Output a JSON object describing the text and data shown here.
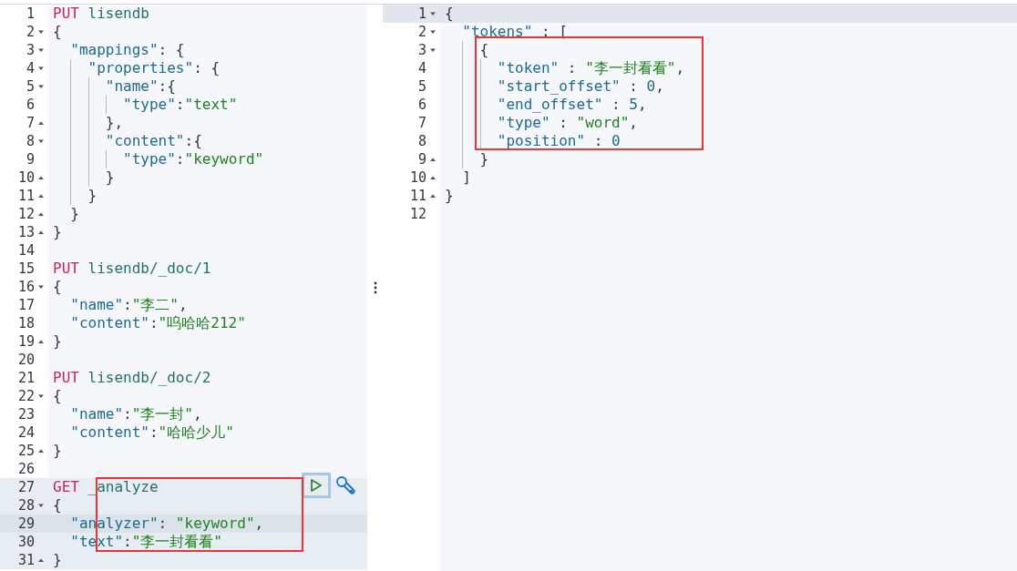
{
  "request_editor": {
    "lines": [
      {
        "number": "1",
        "fold_start": false,
        "fold_end": false,
        "in_request": false,
        "current": false,
        "tokens": [
          {
            "kind": "method",
            "text": "PUT"
          },
          {
            "kind": "path",
            "text": " lisendb"
          }
        ]
      },
      {
        "number": "2",
        "fold_start": true,
        "fold_end": false,
        "in_request": false,
        "current": false,
        "tokens": [
          {
            "kind": "punct",
            "text": "{"
          }
        ],
        "children": [
          {
            "number": "3",
            "fold_start": true,
            "fold_end": false,
            "in_request": false,
            "current": false,
            "tokens": [
              {
                "kind": "key",
                "text": "\"mappings\""
              },
              {
                "kind": "punct",
                "text": ": {"
              }
            ],
            "children": [
              {
                "number": "4",
                "fold_start": true,
                "fold_end": false,
                "in_request": false,
                "current": false,
                "tokens": [
                  {
                    "kind": "key",
                    "text": "\"properties\""
                  },
                  {
                    "kind": "punct",
                    "text": ": {"
                  }
                ],
                "children": [
                  {
                    "number": "5",
                    "fold_start": true,
                    "fold_end": false,
                    "in_request": false,
                    "current": false,
                    "tokens": [
                      {
                        "kind": "key",
                        "text": "\"name\""
                      },
                      {
                        "kind": "punct",
                        "text": ":{"
                      }
                    ],
                    "children": [
                      {
                        "number": "6",
                        "fold_start": false,
                        "fold_end": false,
                        "in_request": false,
                        "current": false,
                        "tokens": [
                          {
                            "kind": "key",
                            "text": "\"type\""
                          },
                          {
                            "kind": "punct",
                            "text": ":"
                          },
                          {
                            "kind": "string",
                            "text": "\"text\""
                          }
                        ]
                      }
                    ]
                  },
                  {
                    "number": "7",
                    "fold_start": false,
                    "fold_end": true,
                    "in_request": false,
                    "current": false,
                    "tokens": [
                      {
                        "kind": "punct",
                        "text": "},"
                      }
                    ]
                  },
                  {
                    "number": "8",
                    "fold_start": true,
                    "fold_end": false,
                    "in_request": false,
                    "current": false,
                    "tokens": [
                      {
                        "kind": "key",
                        "text": "\"content\""
                      },
                      {
                        "kind": "punct",
                        "text": ":{"
                      }
                    ],
                    "children": [
                      {
                        "number": "9",
                        "fold_start": false,
                        "fold_end": false,
                        "in_request": false,
                        "current": false,
                        "tokens": [
                          {
                            "kind": "key",
                            "text": "\"type\""
                          },
                          {
                            "kind": "punct",
                            "text": ":"
                          },
                          {
                            "kind": "string",
                            "text": "\"keyword\""
                          }
                        ]
                      }
                    ]
                  },
                  {
                    "number": "10",
                    "fold_start": false,
                    "fold_end": true,
                    "in_request": false,
                    "current": false,
                    "tokens": [
                      {
                        "kind": "punct",
                        "text": "}"
                      }
                    ]
                  }
                ]
              },
              {
                "number": "11",
                "fold_start": false,
                "fold_end": true,
                "in_request": false,
                "current": false,
                "tokens": [
                  {
                    "kind": "punct",
                    "text": "}"
                  }
                ]
              }
            ]
          },
          {
            "number": "12",
            "fold_start": false,
            "fold_end": true,
            "in_request": false,
            "current": false,
            "tokens": [
              {
                "kind": "punct",
                "text": "}"
              }
            ]
          }
        ]
      },
      {
        "number": "13",
        "fold_start": false,
        "fold_end": true,
        "in_request": false,
        "current": false,
        "tokens": [
          {
            "kind": "punct",
            "text": "}"
          }
        ]
      },
      {
        "number": "14",
        "fold_start": false,
        "fold_end": false,
        "in_request": false,
        "current": false
      },
      {
        "number": "15",
        "fold_start": false,
        "fold_end": false,
        "in_request": false,
        "current": false,
        "tokens": [
          {
            "kind": "method",
            "text": "PUT"
          },
          {
            "kind": "path",
            "text": " lisendb/_doc/1"
          }
        ]
      },
      {
        "number": "16",
        "fold_start": true,
        "fold_end": false,
        "in_request": false,
        "current": false,
        "tokens": [
          {
            "kind": "punct",
            "text": "{"
          }
        ],
        "children": [
          {
            "number": "17",
            "fold_start": false,
            "fold_end": false,
            "in_request": false,
            "current": false,
            "tokens": [
              {
                "kind": "key",
                "text": "\"name\""
              },
              {
                "kind": "punct",
                "text": ":"
              },
              {
                "kind": "string",
                "text": "\"李二\""
              },
              {
                "kind": "punct",
                "text": ","
              }
            ]
          },
          {
            "number": "18",
            "fold_start": false,
            "fold_end": false,
            "in_request": false,
            "current": false,
            "tokens": [
              {
                "kind": "key",
                "text": "\"content\""
              },
              {
                "kind": "punct",
                "text": ":"
              },
              {
                "kind": "string",
                "text": "\"呜哈哈212\""
              }
            ]
          }
        ]
      },
      {
        "number": "19",
        "fold_start": false,
        "fold_end": true,
        "in_request": false,
        "current": false,
        "tokens": [
          {
            "kind": "punct",
            "text": "}"
          }
        ]
      },
      {
        "number": "20",
        "fold_start": false,
        "fold_end": false,
        "in_request": false,
        "current": false
      },
      {
        "number": "21",
        "fold_start": false,
        "fold_end": false,
        "in_request": false,
        "current": false,
        "tokens": [
          {
            "kind": "method",
            "text": "PUT"
          },
          {
            "kind": "path",
            "text": " lisendb/_doc/2"
          }
        ]
      },
      {
        "number": "22",
        "fold_start": true,
        "fold_end": false,
        "in_request": false,
        "current": false,
        "tokens": [
          {
            "kind": "punct",
            "text": "{"
          }
        ],
        "children": [
          {
            "number": "23",
            "fold_start": false,
            "fold_end": false,
            "in_request": false,
            "current": false,
            "tokens": [
              {
                "kind": "key",
                "text": "\"name\""
              },
              {
                "kind": "punct",
                "text": ":"
              },
              {
                "kind": "string",
                "text": "\"李一封\""
              },
              {
                "kind": "punct",
                "text": ","
              }
            ]
          },
          {
            "number": "24",
            "fold_start": false,
            "fold_end": false,
            "in_request": false,
            "current": false,
            "tokens": [
              {
                "kind": "key",
                "text": "\"content\""
              },
              {
                "kind": "punct",
                "text": ":"
              },
              {
                "kind": "string",
                "text": "\"哈哈少儿\""
              }
            ]
          }
        ]
      },
      {
        "number": "25",
        "fold_start": false,
        "fold_end": true,
        "in_request": false,
        "current": false,
        "tokens": [
          {
            "kind": "punct",
            "text": "}"
          }
        ]
      },
      {
        "number": "26",
        "fold_start": false,
        "fold_end": false,
        "in_request": false,
        "current": false
      },
      {
        "number": "27",
        "fold_start": false,
        "fold_end": false,
        "in_request": true,
        "current": false,
        "tokens": [
          {
            "kind": "method",
            "text": "GET"
          },
          {
            "kind": "path",
            "text": " _analyze"
          }
        ]
      },
      {
        "number": "28",
        "fold_start": true,
        "fold_end": false,
        "in_request": true,
        "current": false,
        "tokens": [
          {
            "kind": "punct",
            "text": "{"
          }
        ],
        "children": [
          {
            "number": "29",
            "fold_start": false,
            "fold_end": false,
            "in_request": true,
            "current": true,
            "tokens": [
              {
                "kind": "key",
                "text": "\"analyzer\""
              },
              {
                "kind": "punct",
                "text": ": "
              },
              {
                "kind": "string",
                "text": "\"keyword\""
              },
              {
                "kind": "punct",
                "text": ","
              }
            ]
          },
          {
            "number": "30",
            "fold_start": false,
            "fold_end": false,
            "in_request": true,
            "current": false,
            "tokens": [
              {
                "kind": "key",
                "text": "\"text\""
              },
              {
                "kind": "punct",
                "text": ":"
              },
              {
                "kind": "string",
                "text": "\"李一封看看\""
              }
            ]
          }
        ]
      },
      {
        "number": "31",
        "fold_start": false,
        "fold_end": true,
        "in_request": true,
        "current": false,
        "tokens": [
          {
            "kind": "punct",
            "text": "}"
          }
        ]
      }
    ]
  },
  "response_editor": {
    "lines": [
      {
        "number": "1",
        "fold_start": true,
        "fold_end": false,
        "in_request": false,
        "current": true,
        "tokens": [
          {
            "kind": "punct",
            "text": "{"
          }
        ],
        "children": [
          {
            "number": "2",
            "fold_start": true,
            "fold_end": false,
            "in_request": false,
            "current": false,
            "tokens": [
              {
                "kind": "key",
                "text": "\"tokens\""
              },
              {
                "kind": "punct",
                "text": " : ["
              }
            ],
            "children": [
              {
                "number": "3",
                "fold_start": true,
                "fold_end": false,
                "in_request": false,
                "current": false,
                "tokens": [
                  {
                    "kind": "punct",
                    "text": "{"
                  }
                ],
                "children": [
                  {
                    "number": "4",
                    "fold_start": false,
                    "fold_end": false,
                    "in_request": false,
                    "current": false,
                    "tokens": [
                      {
                        "kind": "key",
                        "text": "\"token\""
                      },
                      {
                        "kind": "punct",
                        "text": " : "
                      },
                      {
                        "kind": "string",
                        "text": "\"李一封看看\""
                      },
                      {
                        "kind": "punct",
                        "text": ","
                      }
                    ]
                  },
                  {
                    "number": "5",
                    "fold_start": false,
                    "fold_end": false,
                    "in_request": false,
                    "current": false,
                    "tokens": [
                      {
                        "kind": "key",
                        "text": "\"start_offset\""
                      },
                      {
                        "kind": "punct",
                        "text": " : "
                      },
                      {
                        "kind": "number",
                        "text": "0"
                      },
                      {
                        "kind": "punct",
                        "text": ","
                      }
                    ]
                  },
                  {
                    "number": "6",
                    "fold_start": false,
                    "fold_end": false,
                    "in_request": false,
                    "current": false,
                    "tokens": [
                      {
                        "kind": "key",
                        "text": "\"end_offset\""
                      },
                      {
                        "kind": "punct",
                        "text": " : "
                      },
                      {
                        "kind": "number",
                        "text": "5"
                      },
                      {
                        "kind": "punct",
                        "text": ","
                      }
                    ]
                  },
                  {
                    "number": "7",
                    "fold_start": false,
                    "fold_end": false,
                    "in_request": false,
                    "current": false,
                    "tokens": [
                      {
                        "kind": "key",
                        "text": "\"type\""
                      },
                      {
                        "kind": "punct",
                        "text": " : "
                      },
                      {
                        "kind": "string",
                        "text": "\"word\""
                      },
                      {
                        "kind": "punct",
                        "text": ","
                      }
                    ]
                  },
                  {
                    "number": "8",
                    "fold_start": false,
                    "fold_end": false,
                    "in_request": false,
                    "current": false,
                    "tokens": [
                      {
                        "kind": "key",
                        "text": "\"position\""
                      },
                      {
                        "kind": "punct",
                        "text": " : "
                      },
                      {
                        "kind": "number",
                        "text": "0"
                      }
                    ]
                  }
                ]
              },
              {
                "number": "9",
                "fold_start": false,
                "fold_end": true,
                "in_request": false,
                "current": false,
                "tokens": [
                  {
                    "kind": "punct",
                    "text": "}"
                  }
                ]
              }
            ]
          },
          {
            "number": "10",
            "fold_start": false,
            "fold_end": true,
            "in_request": false,
            "current": false,
            "tokens": [
              {
                "kind": "punct",
                "text": "]"
              }
            ]
          }
        ]
      },
      {
        "number": "11",
        "fold_start": false,
        "fold_end": true,
        "in_request": false,
        "current": false,
        "tokens": [
          {
            "kind": "punct",
            "text": "}"
          }
        ]
      },
      {
        "number": "12",
        "fold_start": false,
        "fold_end": false,
        "in_request": false,
        "current": false
      }
    ]
  }
}
